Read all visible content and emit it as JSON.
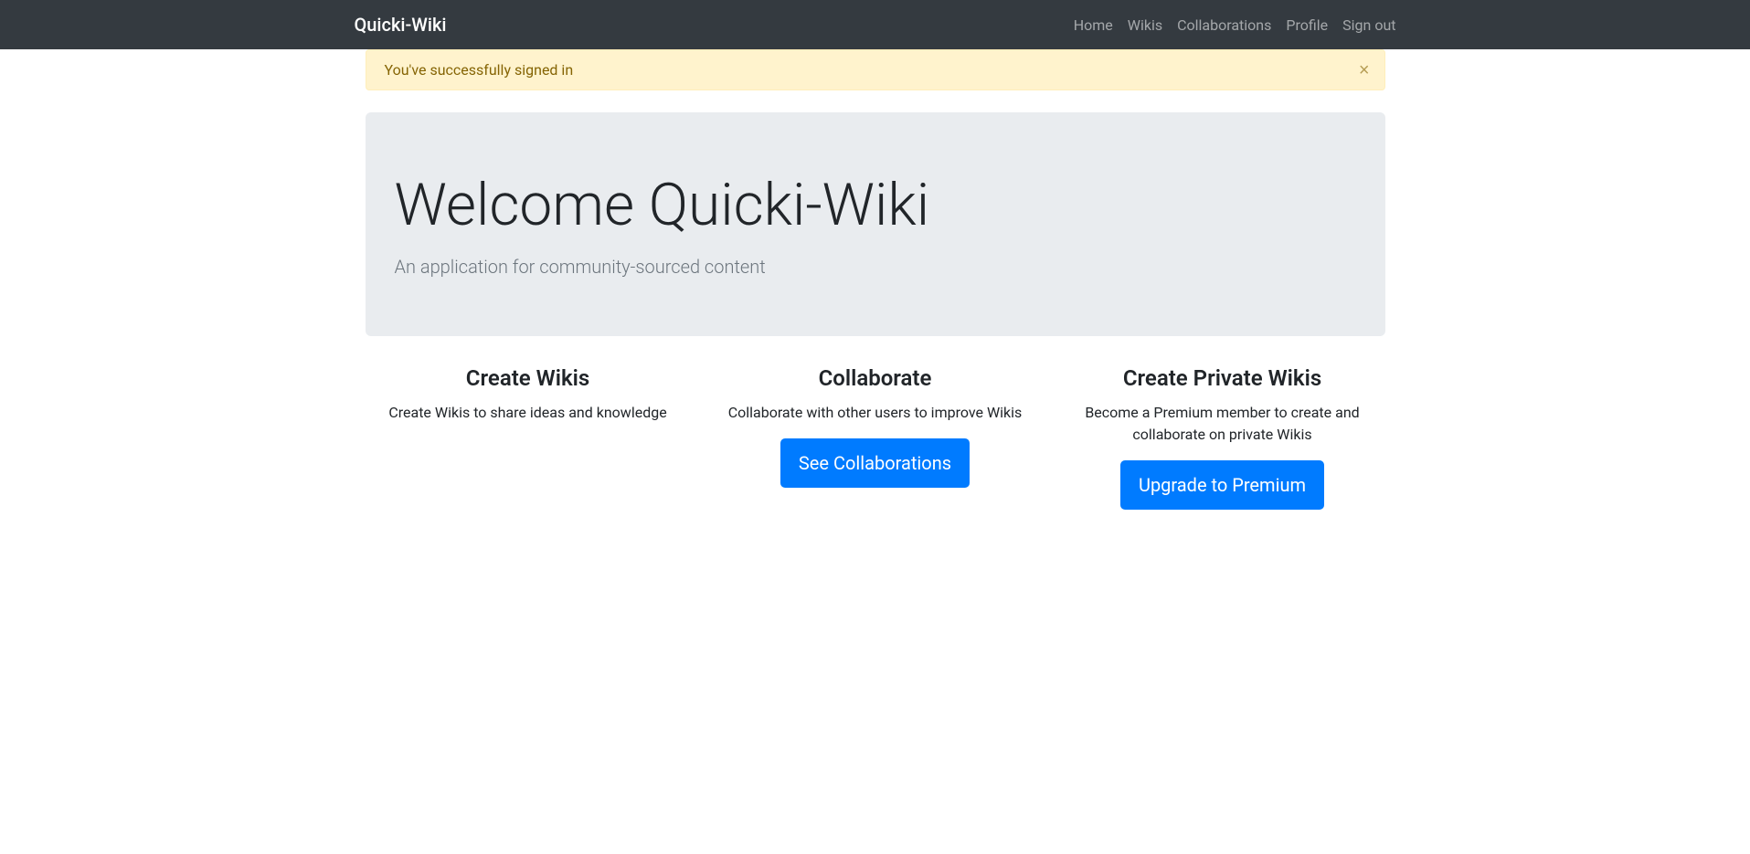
{
  "navbar": {
    "brand": "Quicki-Wiki",
    "links": {
      "home": "Home",
      "wikis": "Wikis",
      "collaborations": "Collaborations",
      "profile": "Profile",
      "signout": "Sign out"
    }
  },
  "alert": {
    "message": "You've successfully signed in",
    "close": "×"
  },
  "jumbotron": {
    "title": "Welcome Quicki-Wiki",
    "subtitle": "An application for community-sourced content"
  },
  "columns": {
    "create": {
      "title": "Create Wikis",
      "text": "Create Wikis to share ideas and knowledge"
    },
    "collaborate": {
      "title": "Collaborate",
      "text": "Collaborate with other users to improve Wikis",
      "button": "See Collaborations"
    },
    "private": {
      "title": "Create Private Wikis",
      "text": "Become a Premium member to create and collaborate on private Wikis",
      "button": "Upgrade to Premium"
    }
  }
}
